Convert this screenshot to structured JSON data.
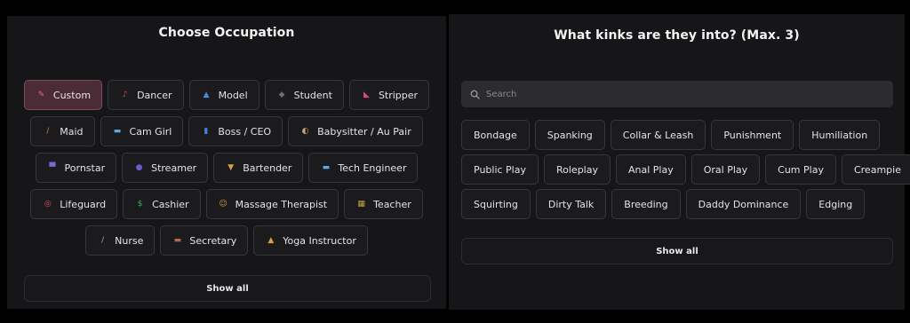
{
  "occupation": {
    "title": "Choose Occupation",
    "rows": [
      [
        {
          "label": "Custom",
          "icon": "magic-wand-icon",
          "glyph": "✎",
          "color": "#e66a9a",
          "selected": true
        },
        {
          "label": "Dancer",
          "icon": "dancer-icon",
          "glyph": "♪",
          "color": "#d14b4b"
        },
        {
          "label": "Model",
          "icon": "dress-icon",
          "glyph": "▲",
          "color": "#4a8be0"
        },
        {
          "label": "Student",
          "icon": "graduation-cap-icon",
          "glyph": "◆",
          "color": "#6b6b78"
        },
        {
          "label": "Stripper",
          "icon": "high-heel-icon",
          "glyph": "◣",
          "color": "#e04a7a"
        }
      ],
      [
        {
          "label": "Maid",
          "icon": "broom-icon",
          "glyph": "/",
          "color": "#c98a3a"
        },
        {
          "label": "Cam Girl",
          "icon": "laptop-icon",
          "glyph": "▬",
          "color": "#5aa6e6"
        },
        {
          "label": "Boss / CEO",
          "icon": "office-building-icon",
          "glyph": "▮",
          "color": "#4a7be0"
        },
        {
          "label": "Babysitter / Au Pair",
          "icon": "baby-bottle-icon",
          "glyph": "◐",
          "color": "#c9a37a"
        }
      ],
      [
        {
          "label": "Pornstar",
          "icon": "clapper-board-icon",
          "glyph": "▀",
          "color": "#7a6ad8"
        },
        {
          "label": "Streamer",
          "icon": "game-controller-icon",
          "glyph": "●",
          "color": "#6b5ac9"
        },
        {
          "label": "Bartender",
          "icon": "cocktail-glass-icon",
          "glyph": "▼",
          "color": "#d9a040"
        },
        {
          "label": "Tech Engineer",
          "icon": "computer-icon",
          "glyph": "▬",
          "color": "#5aa6e6"
        }
      ],
      [
        {
          "label": "Lifeguard",
          "icon": "lifebuoy-icon",
          "glyph": "◎",
          "color": "#e05050"
        },
        {
          "label": "Cashier",
          "icon": "money-icon",
          "glyph": "$",
          "color": "#3fae5a"
        },
        {
          "label": "Massage Therapist",
          "icon": "massage-icon",
          "glyph": "☺",
          "color": "#d9a040"
        },
        {
          "label": "Teacher",
          "icon": "chalkboard-icon",
          "glyph": "▦",
          "color": "#c9a040"
        }
      ],
      [
        {
          "label": "Nurse",
          "icon": "syringe-icon",
          "glyph": "/",
          "color": "#7ab0e6"
        },
        {
          "label": "Secretary",
          "icon": "briefcase-icon",
          "glyph": "▬",
          "color": "#b06a4a"
        },
        {
          "label": "Yoga Instructor",
          "icon": "yoga-icon",
          "glyph": "▲",
          "color": "#d9a040"
        }
      ]
    ],
    "show_all": "Show all"
  },
  "kinks": {
    "title": "What kinks are they into? (Max. 3)",
    "search_placeholder": "Search",
    "rows": [
      [
        "Bondage",
        "Spanking",
        "Collar & Leash",
        "Punishment",
        "Humiliation"
      ],
      [
        "Public Play",
        "Roleplay",
        "Anal Play",
        "Oral Play",
        "Cum Play",
        "Creampie"
      ],
      [
        "Squirting",
        "Dirty Talk",
        "Breeding",
        "Daddy Dominance",
        "Edging"
      ]
    ],
    "show_all": "Show all"
  }
}
